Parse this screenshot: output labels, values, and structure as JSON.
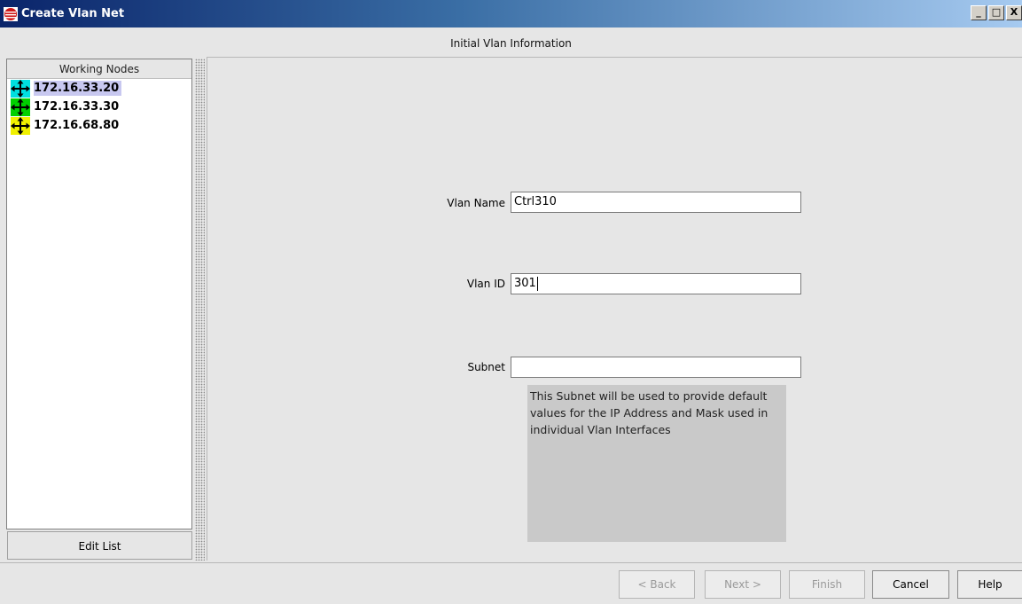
{
  "window": {
    "title": "Create Vlan Net",
    "app_icon": "network-icon",
    "controls": [
      "_",
      "□",
      "X"
    ]
  },
  "header": {
    "label": "Initial Vlan Information"
  },
  "nodes_panel": {
    "title": "Working Nodes",
    "nodes": [
      {
        "label": "172.16.33.20",
        "color": "#00e0e0",
        "selected": true
      },
      {
        "label": "172.16.33.30",
        "color": "#00d000",
        "selected": false
      },
      {
        "label": "172.16.68.80",
        "color": "#f0f000",
        "selected": false
      }
    ],
    "edit_button": "Edit List"
  },
  "form": {
    "vlan_name": {
      "label": "Vlan Name",
      "value": "Ctrl310"
    },
    "vlan_id": {
      "label": "Vlan ID",
      "value": "301"
    },
    "subnet": {
      "label": "Subnet",
      "value": ""
    },
    "subnet_info": "This Subnet will be used to provide default values for the IP Address and Mask used in individual Vlan Interfaces"
  },
  "buttons": {
    "back": "< Back",
    "next": "Next >",
    "finish": "Finish",
    "cancel": "Cancel",
    "help": "Help"
  }
}
